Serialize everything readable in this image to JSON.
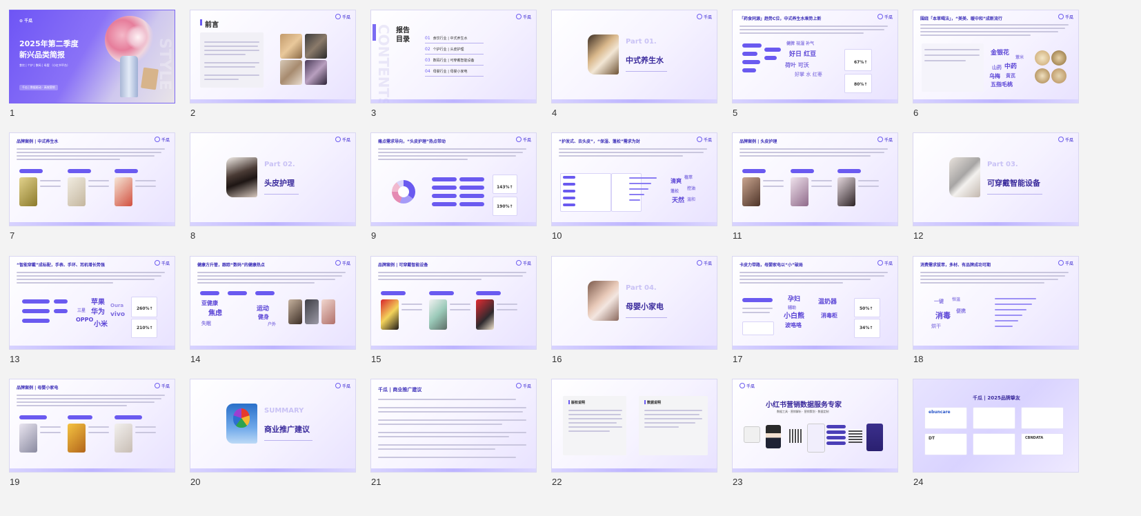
{
  "slides": [
    {
      "n": "1",
      "title": "2025年第二季度",
      "subtitle": "新兴品类简报",
      "tags": "食饮 | 个护 | 数码 | 母婴 （小红书平台）",
      "footer": "千瓜 | 数据驱动 · 高效营销",
      "logo": "千瓜",
      "side_text": "STYLE"
    },
    {
      "n": "2",
      "heading": "前言",
      "logo": "千瓜"
    },
    {
      "n": "3",
      "heading_line1": "报告",
      "heading_line2": "目录",
      "watermark": "CONTENTS",
      "logo": "千瓜",
      "toc": [
        {
          "no": "01",
          "text": "食饮行业 | 中式养生水"
        },
        {
          "no": "02",
          "text": "个护行业 | 头皮护理"
        },
        {
          "no": "03",
          "text": "数码行业 | 可穿戴智能设备"
        },
        {
          "no": "04",
          "text": "母婴行业 | 母婴小家电"
        }
      ]
    },
    {
      "n": "4",
      "part": "Part 01.",
      "title": "中式养生水",
      "logo": "千瓜"
    },
    {
      "n": "5",
      "heading": "「药食同源」趋势C位，中式养生水乘势上新",
      "logo": "千瓜",
      "stat1": "67%↑",
      "stat2": "80%↑"
    },
    {
      "n": "6",
      "heading": "围绕「本草喝法」，“美美、暖中和”成新流行",
      "logo": "千瓜",
      "words": [
        "金银花",
        "薏米",
        "山药",
        "中药",
        "黄芪",
        "乌梅",
        "五指毛桃",
        "荷叶",
        "红豆"
      ]
    },
    {
      "n": "7",
      "heading": "品牌案例 | 中式养生水",
      "logo": "千瓜"
    },
    {
      "n": "8",
      "part": "Part 02.",
      "title": "头皮护理",
      "logo": "千瓜"
    },
    {
      "n": "9",
      "heading": "痛点需求导向，“头皮护理”热点带动",
      "logo": "千瓜",
      "stat1": "143%↑",
      "stat2": "190%↑"
    },
    {
      "n": "10",
      "heading": "“护发式、去头皮”，“保湿、蓬松”需求为封",
      "logo": "千瓜",
      "words": [
        "清爽",
        "植萃",
        "控油",
        "蓬松",
        "天然",
        "温和"
      ]
    },
    {
      "n": "11",
      "heading": "品牌案例 | 头皮护理",
      "logo": "千瓜"
    },
    {
      "n": "12",
      "part": "Part 03.",
      "title": "可穿戴智能设备",
      "logo": "千瓜"
    },
    {
      "n": "13",
      "heading": "“智能穿戴”成标配，手表、手环、耳机增长势强",
      "logo": "千瓜",
      "words": [
        "苹果",
        "华为",
        "OPPO",
        "小米",
        "vivo",
        "Oura",
        "三星"
      ],
      "stat1": "260%↑",
      "stat2": "210%↑"
    },
    {
      "n": "14",
      "heading": "健康方升管，跟踪“数码”的健康热点",
      "logo": "千瓜",
      "words": [
        "亚健康",
        "焦虑",
        "运动",
        "健身",
        "失眠",
        "户外"
      ]
    },
    {
      "n": "15",
      "heading": "品牌案例 | 可穿戴智能设备",
      "logo": "千瓜"
    },
    {
      "n": "16",
      "part": "Part 04.",
      "title": "母婴小家电",
      "logo": "千瓜"
    },
    {
      "n": "17",
      "heading": "卡皮力带路，母婴家电以“小”破局",
      "logo": "千瓜",
      "words": [
        "孕妇",
        "辅助",
        "小白熊",
        "波咯咯",
        "温奶器",
        "消毒柜"
      ],
      "stat1": "50%↑",
      "stat2": "34%↑"
    },
    {
      "n": "18",
      "heading": "消费需求拔萃，多材、有品牌成功可期",
      "logo": "千瓜",
      "words": [
        "消毒",
        "一键",
        "恒温",
        "便携",
        "烘干"
      ]
    },
    {
      "n": "19",
      "heading": "品牌案例 | 母婴小家电",
      "logo": "千瓜"
    },
    {
      "n": "20",
      "part": "SUMMARY",
      "title": "商业推广建议",
      "logo": "千瓜"
    },
    {
      "n": "21",
      "heading": "千瓜 | 商业推广建议",
      "logo": "千瓜"
    },
    {
      "n": "22",
      "heading_left": "版权说明",
      "heading_right": "数据说明"
    },
    {
      "n": "23",
      "heading": "小红书营销数据服务专家",
      "sub": "数据工具 · 营销解析 · 营销策划 · 数据定制",
      "logo": "千瓜"
    },
    {
      "n": "24",
      "heading": "千瓜 | 2025品牌挚友",
      "brands": [
        "ebuncare",
        "DT",
        "CBNDATA"
      ]
    }
  ],
  "colors": {
    "accent": "#6a5af0",
    "title": "#3a2a9c",
    "bg": "#f3f3f3"
  }
}
